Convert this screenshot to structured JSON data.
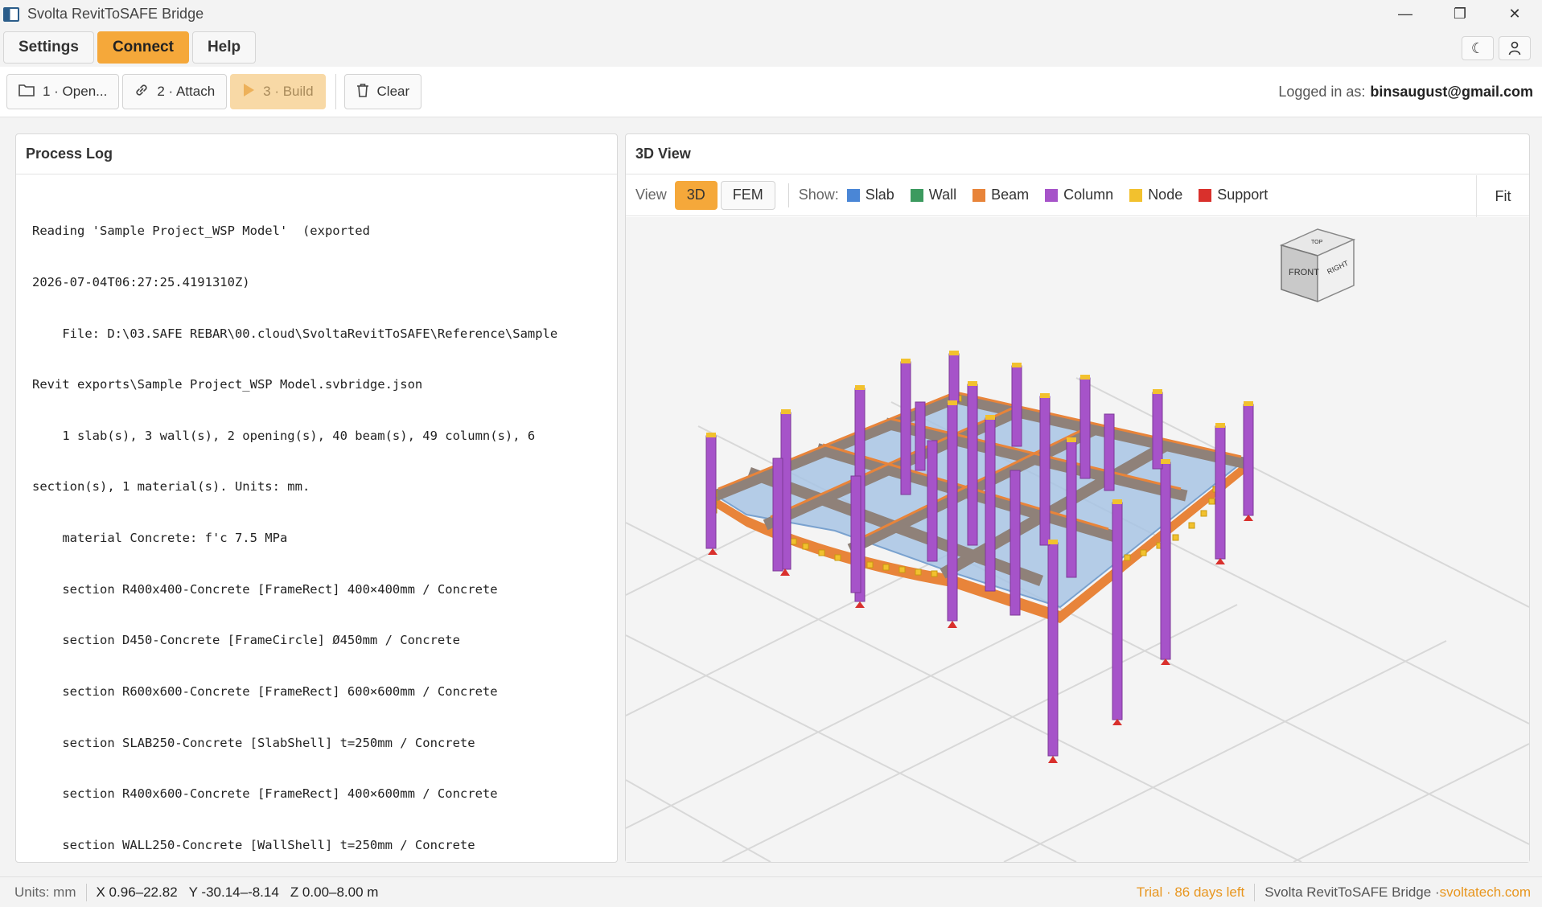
{
  "window": {
    "title": "Svolta RevitToSAFE Bridge",
    "minimize": "—",
    "restore": "❐",
    "close": "✕"
  },
  "menu": {
    "items": [
      "Settings",
      "Connect",
      "Help"
    ],
    "theme_icon": "☾",
    "user_icon": "👤"
  },
  "toolbar": {
    "open_label": "1 · Open...",
    "attach_label": "2 · Attach",
    "build_label": "3 · Build",
    "clear_label": "Clear",
    "logged_in_prefix": "Logged in as:",
    "logged_in_user": "binsaugust@gmail.com"
  },
  "process_log": {
    "title": "Process Log",
    "lines": [
      "Reading 'Sample Project_WSP Model'  (exported",
      "2026-07-04T06:27:25.4191310Z)",
      "    File: D:\\03.SAFE REBAR\\00.cloud\\SvoltaRevitToSAFE\\Reference\\Sample",
      "Revit exports\\Sample Project_WSP Model.svbridge.json",
      "    1 slab(s), 3 wall(s), 2 opening(s), 40 beam(s), 49 column(s), 6",
      "section(s), 1 material(s). Units: mm.",
      "    material Concrete: f'c 7.5 MPa",
      "    section R400x400-Concrete [FrameRect] 400×400mm / Concrete",
      "    section D450-Concrete [FrameCircle] Ø450mm / Concrete",
      "    section R600x600-Concrete [FrameRect] 600×600mm / Concrete",
      "    section SLAB250-Concrete [SlabShell] t=250mm / Concrete",
      "    section R400x600-Concrete [FrameRect] 400×600mm / Concrete",
      "    section WALL250-Concrete [WallShell] t=250mm / Concrete"
    ]
  },
  "view3d": {
    "title": "3D View",
    "view_label": "View",
    "modes": [
      "3D",
      "FEM"
    ],
    "active_mode": "3D",
    "show_label": "Show:",
    "legend": [
      {
        "label": "Slab",
        "color": "#4a86d6"
      },
      {
        "label": "Wall",
        "color": "#3c9a5f"
      },
      {
        "label": "Beam",
        "color": "#e8843a"
      },
      {
        "label": "Column",
        "color": "#a653c9"
      },
      {
        "label": "Node",
        "color": "#f2c12e"
      },
      {
        "label": "Support",
        "color": "#d9302c"
      }
    ],
    "fit_label": "Fit",
    "cube": {
      "front": "FRONT",
      "right": "RIGHT",
      "top": "TOP"
    }
  },
  "status": {
    "units": "Units: mm",
    "x": "X 0.96–22.82",
    "y": "Y -30.14–-8.14",
    "z": "Z 0.00–8.00 m",
    "trial": "Trial · 86 days left",
    "product": "Svolta RevitToSAFE Bridge · ",
    "link": "svoltatech.com"
  }
}
